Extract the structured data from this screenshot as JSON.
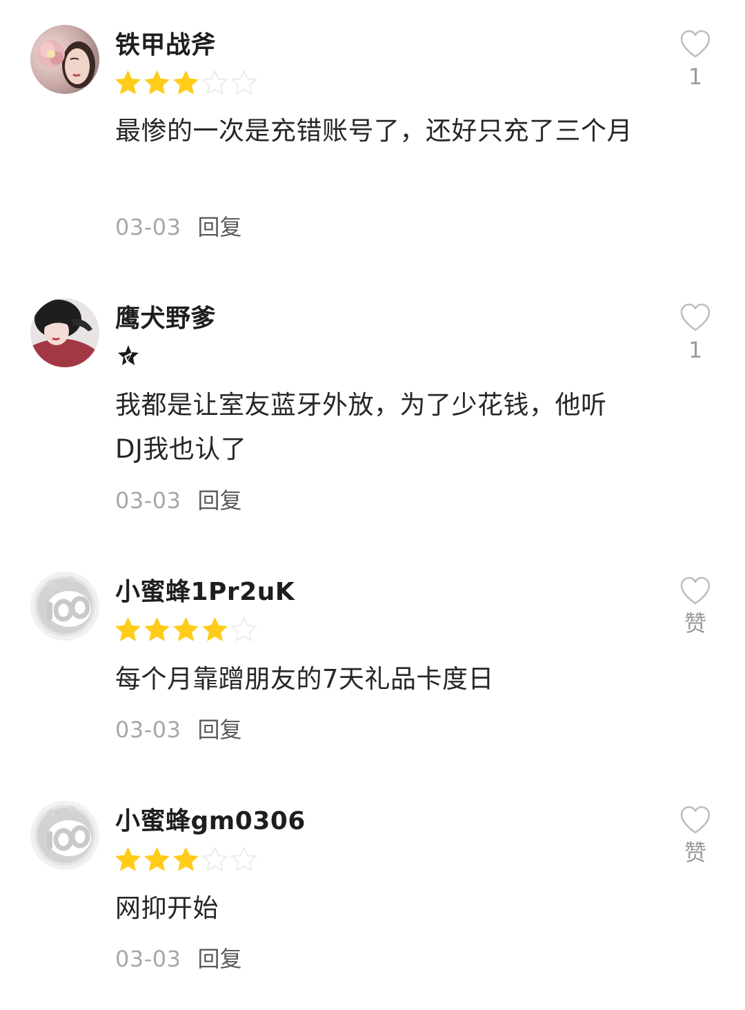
{
  "colors": {
    "star_filled": "#FFCC1A",
    "star_empty": "#EDEDED",
    "heart": "#BDBDBD",
    "date": "#A7A7A7",
    "reply": "#5A5A5A"
  },
  "comments": [
    {
      "username": "铁甲战斧",
      "avatar": "woman-with-flower-photo",
      "rating": 3,
      "rating_max": 5,
      "text": "最惨的一次是充错账号了，还好只充了三个月",
      "date": "03-03",
      "reply_label": "回复",
      "like_icon": "heart-outline-icon",
      "like_count": "1"
    },
    {
      "username": "鹰犬野爹",
      "avatar": "woman-red-sweater-photo",
      "badge_icon": "star-badge-icon",
      "text": "我都是让室友蓝牙外放，为了少花钱，他听DJ我也认了",
      "date": "03-03",
      "reply_label": "回复",
      "like_icon": "heart-outline-icon",
      "like_count": "1"
    },
    {
      "username": "小蜜蜂1Pr2uK",
      "avatar": "default-bee-avatar",
      "rating": 4,
      "rating_max": 5,
      "text": "每个月靠蹭朋友的7天礼品卡度日",
      "date": "03-03",
      "reply_label": "回复",
      "like_icon": "heart-outline-icon",
      "like_count": "赞"
    },
    {
      "username": "小蜜蜂gm0306",
      "avatar": "default-bee-avatar",
      "rating": 3,
      "rating_max": 5,
      "text": "网抑开始",
      "date": "03-03",
      "reply_label": "回复",
      "like_icon": "heart-outline-icon",
      "like_count": "赞"
    }
  ]
}
